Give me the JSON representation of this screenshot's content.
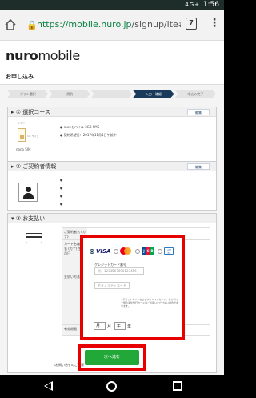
{
  "status_bar": {
    "time": "1:56",
    "network": "4G+"
  },
  "browser": {
    "url_host": "https://mobile.nuro.jp",
    "url_path": "/signup/lte#/inde",
    "tab_count": "7"
  },
  "page": {
    "logo_bold": "nuro",
    "logo_light": "mobile",
    "title": "お申し込み"
  },
  "steps": [
    {
      "label": "プラン選択",
      "active": false
    },
    {
      "label": "規約",
      "active": false
    },
    {
      "label": "",
      "active": false
    },
    {
      "label": "入力・確認",
      "active": true
    },
    {
      "label": "申込み完了",
      "active": false
    }
  ],
  "section1": {
    "heading": "▸ ① 選択コース",
    "edit_label": "編集",
    "bullet1": "● nuroモバイル 3GB SMS",
    "bullet2": "● 契約希望日：2017年11月1日午前中",
    "sim_label": "nano SIM",
    "sim_text": "ここに",
    "sim_note": "1/1 サイズ"
  },
  "section2": {
    "heading": "▸ ② ご契約者情報",
    "edit_label": "編集",
    "bullets": [
      "●",
      "●",
      "●",
      "●"
    ]
  },
  "section3": {
    "heading": "▾ ③ お支払い",
    "rows": {
      "name_kana": "ご契約者名\n(カナ)",
      "card_name": "カード名義人名\n(カナ)\n生年月日",
      "payment_method": "支払い方法",
      "expiry_label": "有効期限"
    },
    "payment": {
      "brand_visa": "VISA",
      "card_number_label": "クレジットカード番号",
      "card_number_placeholder": "例：1234567890123456",
      "security_placeholder": "セキュリティコード",
      "note": "※デビットカードおよびプリペイドカード、ならびに一部の海外発行カードはご利用いただけない場合があります。",
      "month_value": "月",
      "month_unit": "月",
      "year_value": "年",
      "year_unit": "年"
    },
    "remarks": "▸お問い合せのご注意"
  },
  "next_button": "次へ進む"
}
